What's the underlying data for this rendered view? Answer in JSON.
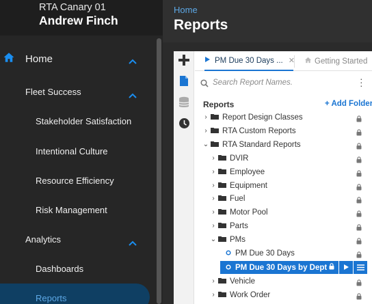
{
  "sidebar": {
    "org_name": "RTA Canary 01",
    "user_name": "Andrew Finch",
    "nav": {
      "home": "Home",
      "fleet_success": "Fleet Success",
      "stakeholder_satisfaction": "Stakeholder Satisfaction",
      "intentional_culture": "Intentional Culture",
      "resource_efficiency": "Resource Efficiency",
      "risk_management": "Risk Management",
      "analytics": "Analytics",
      "dashboards": "Dashboards",
      "reports": "Reports"
    },
    "active_item": "Reports",
    "accent_color": "#1a75d2"
  },
  "header": {
    "breadcrumb": "Home",
    "title": "Reports"
  },
  "tabs": [
    {
      "label": "PM Due 30 Days ...",
      "icon": "play-icon",
      "active": true,
      "closable": true
    },
    {
      "label": "Getting Started",
      "icon": "home-icon",
      "active": false
    }
  ],
  "search": {
    "placeholder": "Search Report Names."
  },
  "tree": {
    "heading": "Reports",
    "add_folder_label": "+ Add Folder",
    "top_folders": [
      {
        "label": "Report Design Classes",
        "expanded": false,
        "locked": true
      },
      {
        "label": "RTA Custom Reports",
        "expanded": false,
        "locked": true
      },
      {
        "label": "RTA Standard Reports",
        "expanded": true,
        "locked": true
      }
    ],
    "standard_folders": [
      {
        "label": "DVIR",
        "expanded": false
      },
      {
        "label": "Employee",
        "expanded": false
      },
      {
        "label": "Equipment",
        "expanded": false
      },
      {
        "label": "Fuel",
        "expanded": false
      },
      {
        "label": "Motor Pool",
        "expanded": false
      },
      {
        "label": "Parts",
        "expanded": false
      },
      {
        "label": "PMs",
        "expanded": true
      }
    ],
    "pm_reports": [
      {
        "label": "PM Due 30 Days",
        "selected": false
      },
      {
        "label": "PM Due 30 Days by Dept",
        "selected": true
      }
    ],
    "after_folders": [
      {
        "label": "Vehicle",
        "expanded": false
      },
      {
        "label": "Work Order",
        "expanded": false
      }
    ]
  }
}
